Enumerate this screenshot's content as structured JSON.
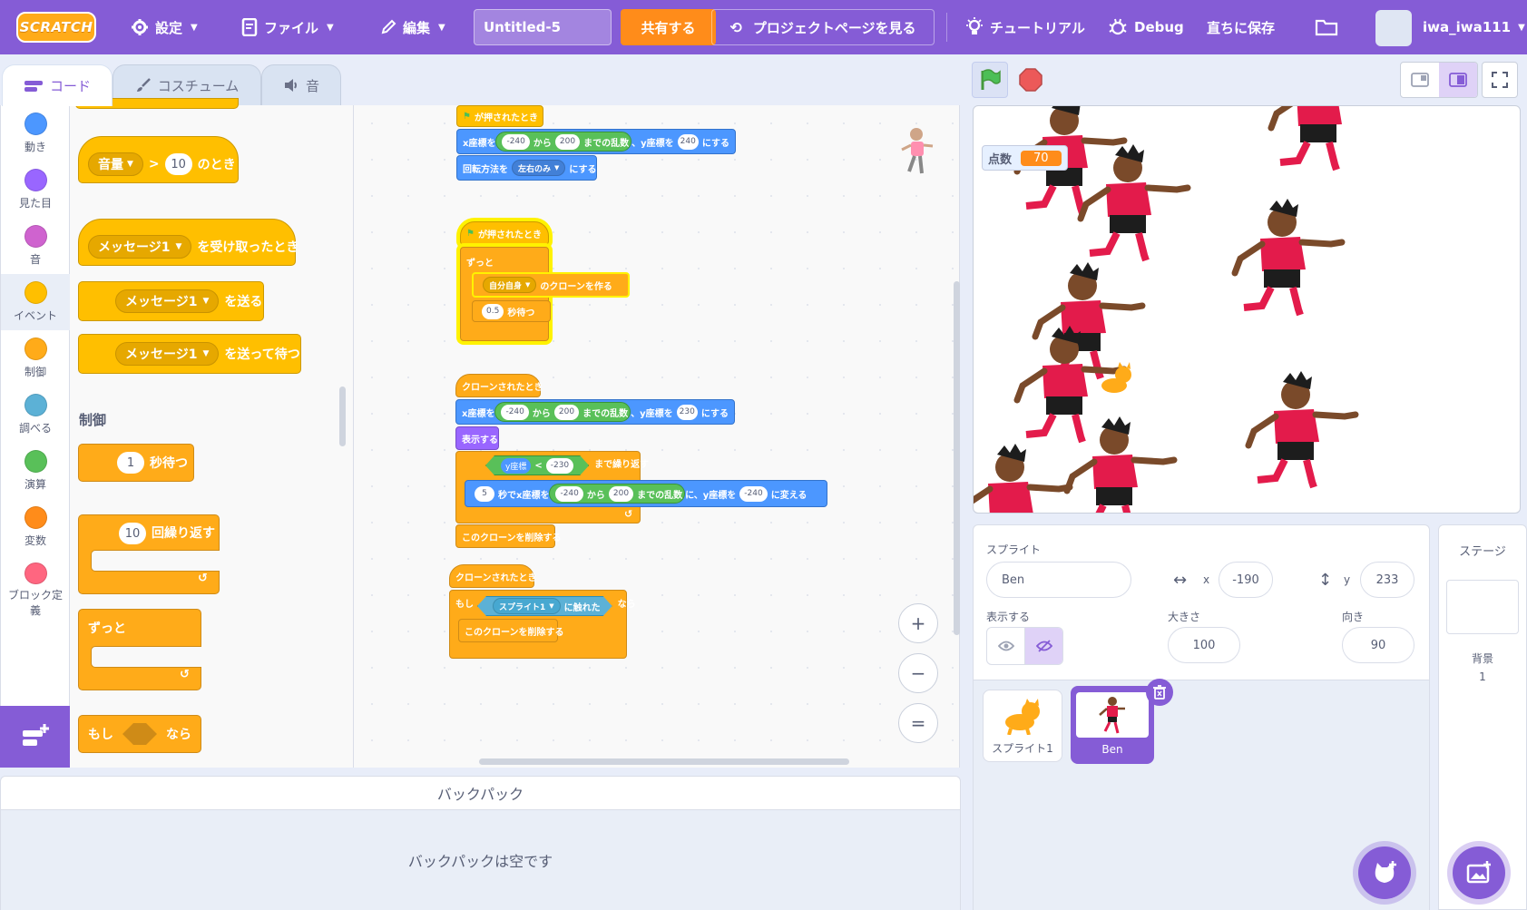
{
  "menubar": {
    "logo": "SCRATCH",
    "settings": "設定",
    "file": "ファイル",
    "edit": "編集",
    "project_title": "Untitled-5",
    "share": "共有する",
    "project_page": "プロジェクトページを見る",
    "tutorials": "チュートリアル",
    "debug": "Debug",
    "save_now": "直ちに保存",
    "username": "iwa_iwa111"
  },
  "tabs": {
    "code": "コード",
    "costumes": "コスチューム",
    "sounds": "音"
  },
  "categories": [
    {
      "label": "動き",
      "color": "#4c97ff"
    },
    {
      "label": "見た目",
      "color": "#9966ff"
    },
    {
      "label": "音",
      "color": "#cf63cf"
    },
    {
      "label": "イベント",
      "color": "#ffbf00"
    },
    {
      "label": "制御",
      "color": "#ffab19"
    },
    {
      "label": "調べる",
      "color": "#5cb1d6"
    },
    {
      "label": "演算",
      "color": "#59c059"
    },
    {
      "label": "変数",
      "color": "#ff8c1a"
    },
    {
      "label": "ブロック定義",
      "color": "#ff6680"
    }
  ],
  "palette": {
    "loudness_dd": "音量",
    "gt": ">",
    "loudness_val": "10",
    "when_label": "のとき",
    "msg_dd": "メッセージ1",
    "when_receive": "を受け取ったとき",
    "broadcast": "を送る",
    "broadcast_wait": "を送って待つ",
    "control_heading": "制御",
    "wait_val": "1",
    "wait_label": "秒待つ",
    "repeat_val": "10",
    "repeat_label": "回繰り返す",
    "forever": "ずっと",
    "if_label": "もし",
    "then_label": "なら"
  },
  "script": {
    "flag_clicked": "が押されたとき",
    "x_to": "x座標を",
    "from": "から",
    "random_to": "までの乱数",
    "y_to": "、y座標を",
    "set_to": "にする",
    "neg240": "-240",
    "v200": "200",
    "v240": "240",
    "rot_style": "回転方法を",
    "left_right": "左右のみ",
    "forever": "ずっと",
    "myself": "自分自身",
    "create_clone": "のクローンを作る",
    "wait_half": "0.5",
    "wait_sec": "秒待つ",
    "when_clone": "クローンされたとき",
    "v230": "230",
    "show": "表示する",
    "y_pos": "y座標",
    "lt": "<",
    "neg230": "-230",
    "repeat_until": "まで繰り返す",
    "glide_sec": "5",
    "glide_label": "秒でx座標を",
    "glide_y": "に、y座標を",
    "change_label": "に変える",
    "delete_clone": "このクローンを削除する",
    "if_label": "もし",
    "sprite1": "スプライト1",
    "touching": "に触れた",
    "then_label": "なら"
  },
  "zoom": {
    "in": "+",
    "out": "−",
    "reset": "="
  },
  "backpack": {
    "title": "バックパック",
    "empty": "バックパックは空です"
  },
  "stage": {
    "monitor_label": "点数",
    "monitor_value": "70"
  },
  "sprite_info": {
    "sprite_label": "スプライト",
    "sprite_name": "Ben",
    "x_label": "x",
    "x_value": "-190",
    "y_label": "y",
    "y_value": "233",
    "show_label": "表示する",
    "size_label": "大きさ",
    "size_value": "100",
    "direction_label": "向き",
    "direction_value": "90"
  },
  "sprites": [
    {
      "name": "スプライト1",
      "selected": false
    },
    {
      "name": "Ben",
      "selected": true
    }
  ],
  "stage_pane": {
    "title": "ステージ",
    "backdrop_label": "背景",
    "backdrop_count": "1"
  }
}
